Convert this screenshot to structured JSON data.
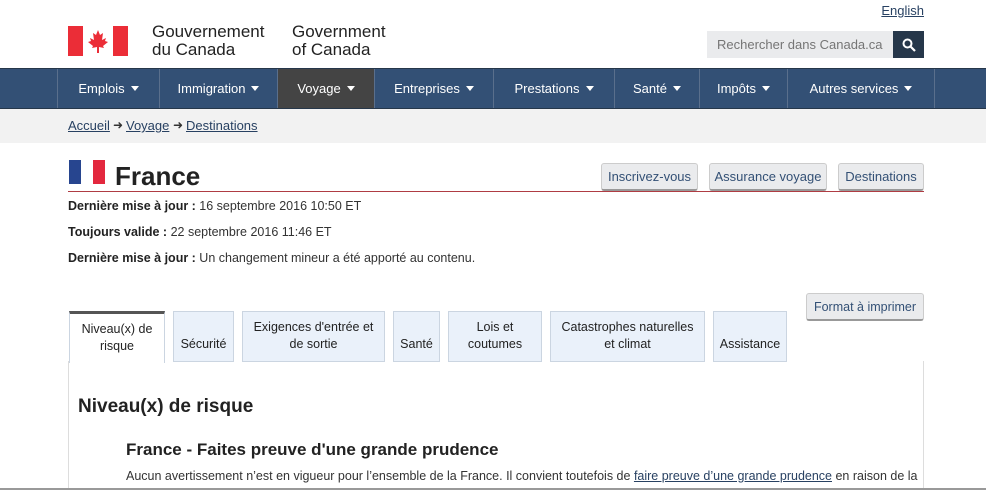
{
  "header": {
    "language_toggle": "English",
    "gov_fr_line1": "Gouvernement",
    "gov_fr_line2": "du Canada",
    "gov_en_line1": "Government",
    "gov_en_line2": "of Canada",
    "search_placeholder": "Rechercher dans Canada.ca",
    "flag_color": "#eb2d37"
  },
  "nav": {
    "items": [
      {
        "label": "Emplois"
      },
      {
        "label": "Immigration"
      },
      {
        "label": "Voyage",
        "active": true
      },
      {
        "label": "Entreprises"
      },
      {
        "label": "Prestations"
      },
      {
        "label": "Santé"
      },
      {
        "label": "Impôts"
      },
      {
        "label": "Autres services"
      }
    ]
  },
  "breadcrumb": [
    "Accueil",
    "Voyage",
    "Destinations"
  ],
  "page": {
    "title": "France",
    "buttons": [
      "Inscrivez-vous",
      "Assurance voyage",
      "Destinations"
    ],
    "meta": [
      {
        "label": "Dernière mise à jour :",
        "value": " 16 septembre 2016 10:50 ET"
      },
      {
        "label": "Toujours valide :",
        "value": " 22 septembre 2016 11:46 ET"
      },
      {
        "label": "Dernière mise à jour :",
        "value": " Un changement mineur a été apporté au contenu."
      }
    ],
    "print_button": "Format à imprimer"
  },
  "tabs": [
    {
      "line1": "Niveau(x) de",
      "line2": "risque",
      "active": true
    },
    {
      "line1": "",
      "line2": "Sécurité"
    },
    {
      "line1": "Exigences d'entrée et",
      "line2": "de sortie"
    },
    {
      "line1": "",
      "line2": "Santé"
    },
    {
      "line1": "Lois et",
      "line2": "coutumes"
    },
    {
      "line1": "Catastrophes naturelles",
      "line2": "et climat"
    },
    {
      "line1": "",
      "line2": "Assistance"
    }
  ],
  "panel": {
    "heading": "Niveau(x) de risque",
    "subheading": "France - Faites preuve d'une grande prudence",
    "text_before": "Aucun avertissement n’est en vigueur pour l’ensemble de la France. Il convient toutefois de ",
    "link": "faire preuve d’une grande prudence",
    "text_after": " en raison de la"
  }
}
